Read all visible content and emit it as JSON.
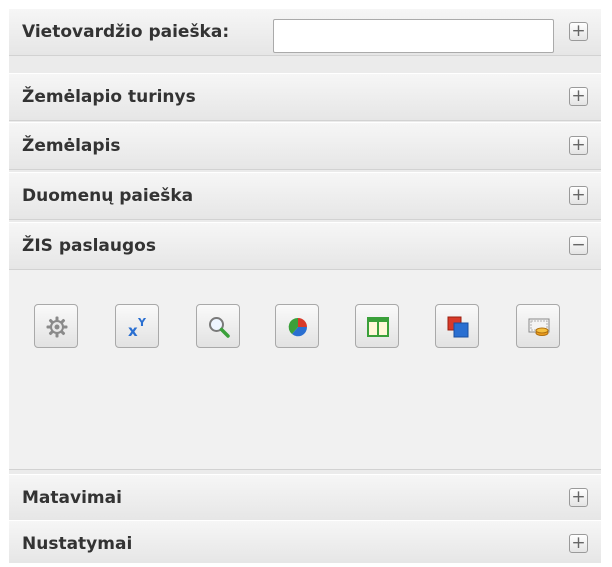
{
  "search": {
    "label": "Vietovardžio paieška:",
    "value": "",
    "placeholder": ""
  },
  "sections": [
    {
      "label": "Žemėlapio turinys",
      "toggle": "+"
    },
    {
      "label": "Žemėlapis",
      "toggle": "+"
    },
    {
      "label": "Duomenų paieška",
      "toggle": "+"
    },
    {
      "label": "ŽIS paslaugos",
      "toggle": "−"
    },
    {
      "label": "Matavimai",
      "toggle": "+"
    },
    {
      "label": "Nustatymai",
      "toggle": "+"
    }
  ],
  "search_toggle": "+",
  "tools": [
    {
      "icon": "gear-icon"
    },
    {
      "icon": "xy-coordinates-icon"
    },
    {
      "icon": "magnifier-icon"
    },
    {
      "icon": "pie-chart-icon"
    },
    {
      "icon": "table-columns-icon"
    },
    {
      "icon": "overlay-layers-icon"
    },
    {
      "icon": "coins-icon"
    }
  ],
  "colors": {
    "accent_green": "#3aa03a",
    "accent_blue": "#2a6fd1",
    "accent_red": "#d83a2a",
    "accent_orange": "#f0a020"
  }
}
